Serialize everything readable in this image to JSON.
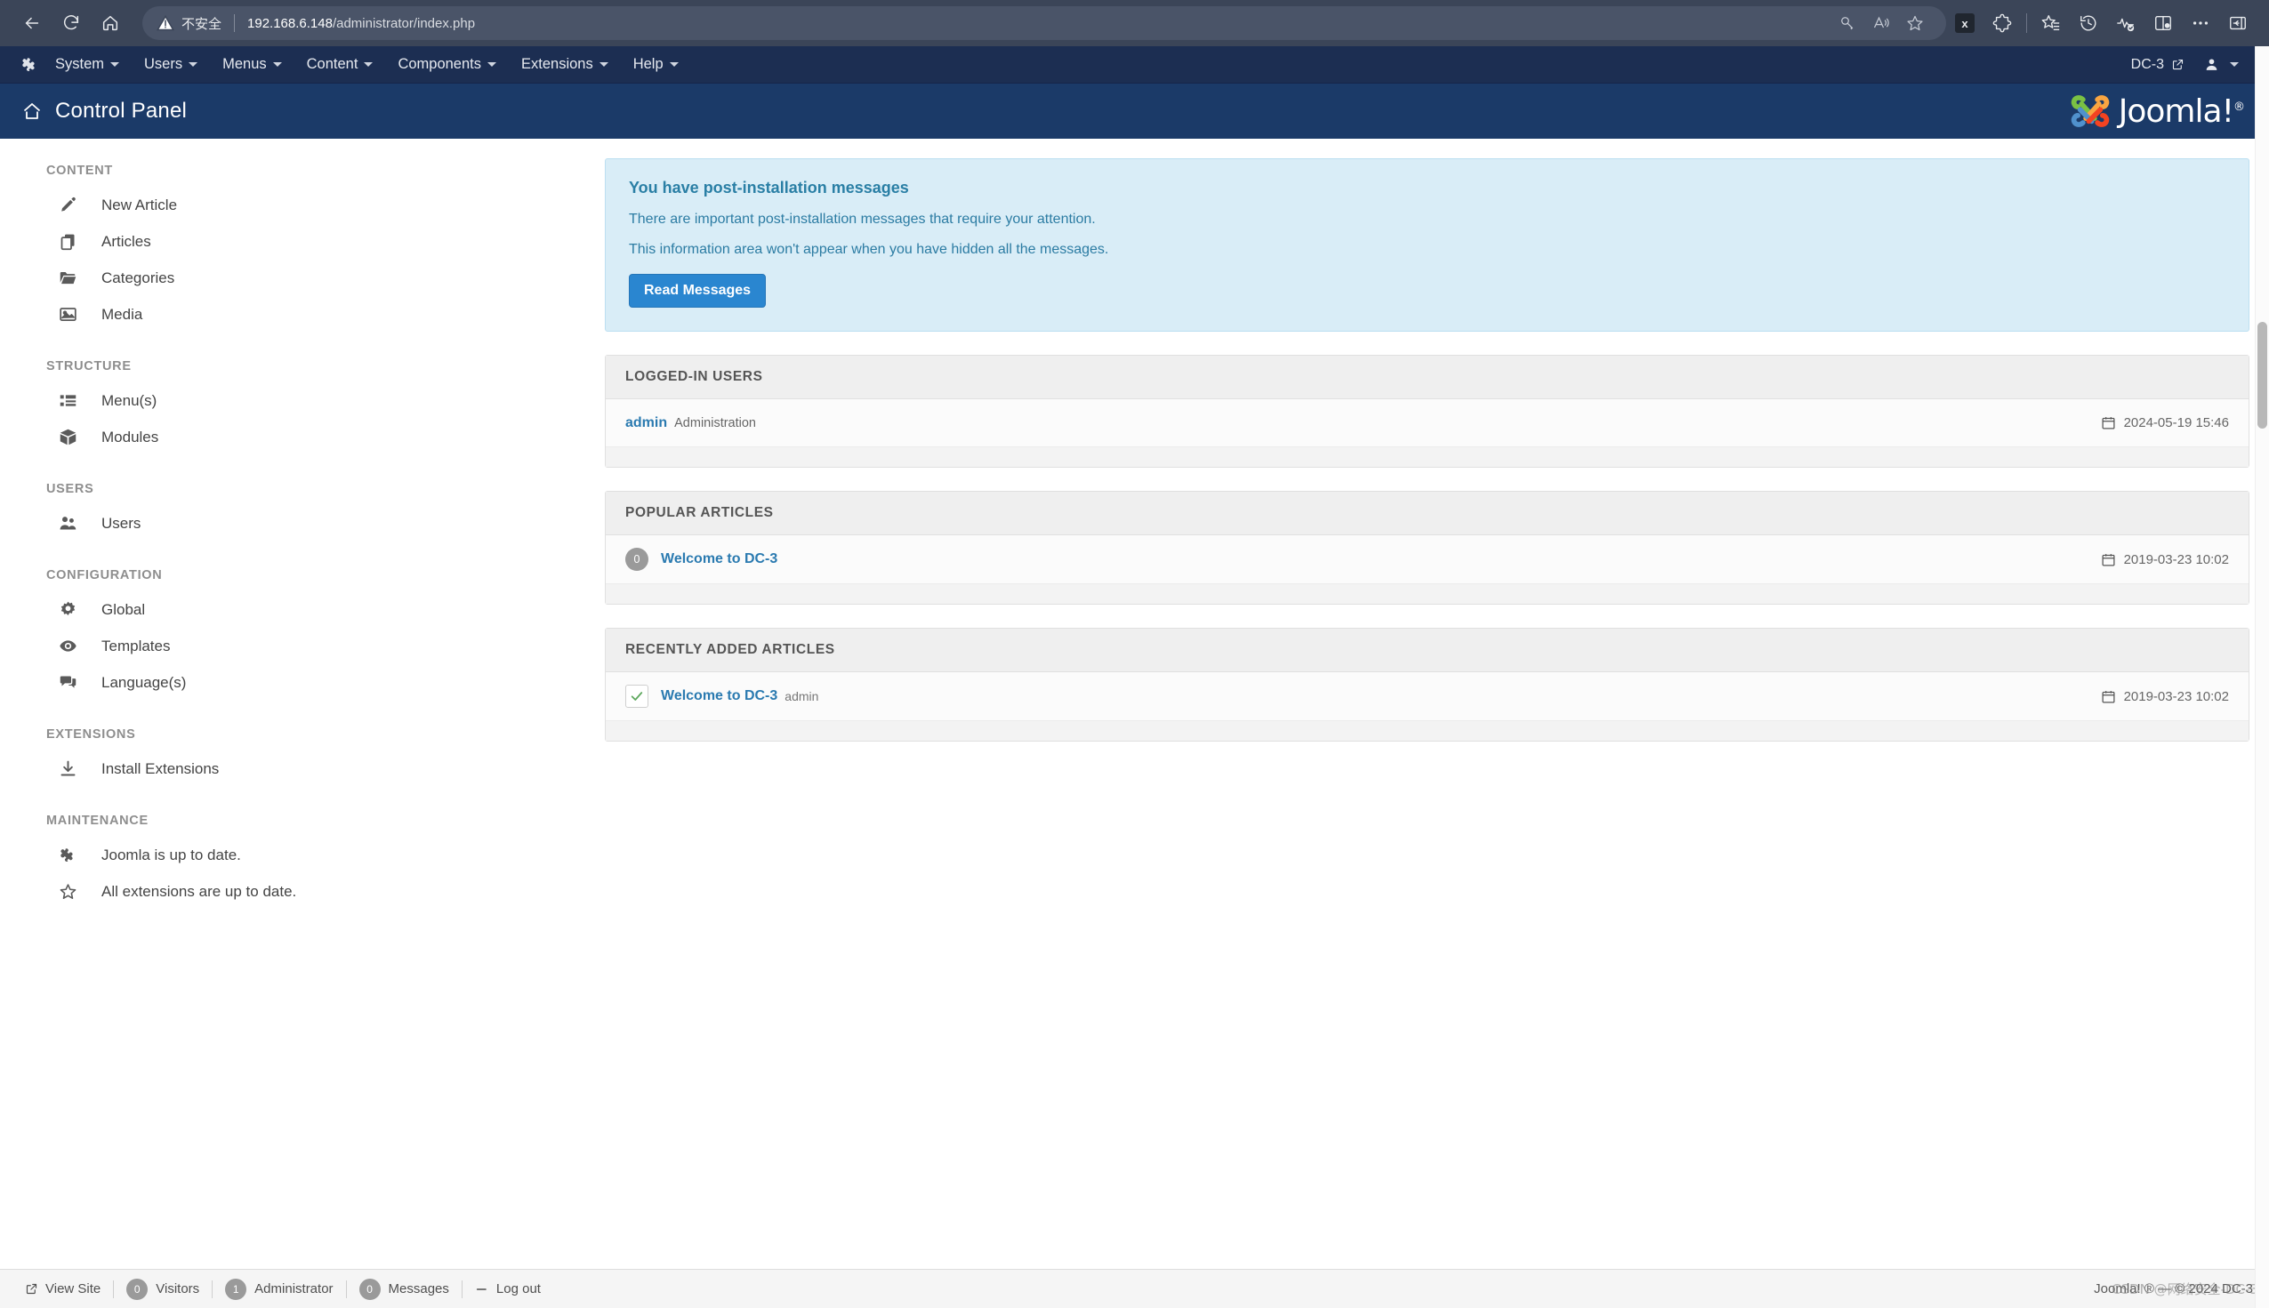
{
  "browser": {
    "back_label": "Back",
    "reload_label": "Reload",
    "home_label": "Home",
    "security_label": "不安全",
    "url_host": "192.168.6.148",
    "url_path": "/administrator/index.php",
    "pill_icons": [
      {
        "name": "key-icon",
        "label": "Key"
      },
      {
        "name": "read-aloud-icon",
        "label": "Read aloud"
      },
      {
        "name": "favorite-star-icon",
        "label": "Add to favorites"
      }
    ],
    "toolbar_icons": [
      {
        "name": "extension-badge-x-icon",
        "label": "X"
      },
      {
        "name": "puzzle-extensions-icon",
        "label": "Extensions"
      },
      {
        "name": "collections-star-icon",
        "label": "Collections"
      },
      {
        "name": "history-clock-icon",
        "label": "History"
      },
      {
        "name": "browser-essentials-icon",
        "label": "Browser essentials"
      },
      {
        "name": "split-screen-icon",
        "label": "Split screen"
      },
      {
        "name": "more-options-icon",
        "label": "Settings and more"
      },
      {
        "name": "sidebar-toggle-icon",
        "label": "Sidebar"
      }
    ]
  },
  "admin_menu": {
    "brand_icon": "joomla-logo-icon",
    "items": [
      {
        "label": "System",
        "has_caret": true
      },
      {
        "label": "Users",
        "has_caret": true
      },
      {
        "label": "Menus",
        "has_caret": true
      },
      {
        "label": "Content",
        "has_caret": true
      },
      {
        "label": "Components",
        "has_caret": true
      },
      {
        "label": "Extensions",
        "has_caret": true
      },
      {
        "label": "Help",
        "has_caret": true
      }
    ],
    "site_name": "DC-3",
    "user_menu_label": ""
  },
  "page_header": {
    "title": "Control Panel",
    "home_icon": "home-icon",
    "logo_text": "Joomla!",
    "logo_registered": "®"
  },
  "sidebar": {
    "groups": [
      {
        "heading": "CONTENT",
        "items": [
          {
            "label": "New Article",
            "icon": "pencil-icon"
          },
          {
            "label": "Articles",
            "icon": "copy-stack-icon"
          },
          {
            "label": "Categories",
            "icon": "folder-icon"
          },
          {
            "label": "Media",
            "icon": "image-icon"
          }
        ]
      },
      {
        "heading": "STRUCTURE",
        "items": [
          {
            "label": "Menu(s)",
            "icon": "list-icon"
          },
          {
            "label": "Modules",
            "icon": "cube-icon"
          }
        ]
      },
      {
        "heading": "USERS",
        "items": [
          {
            "label": "Users",
            "icon": "users-icon"
          }
        ]
      },
      {
        "heading": "CONFIGURATION",
        "items": [
          {
            "label": "Global",
            "icon": "gear-icon"
          },
          {
            "label": "Templates",
            "icon": "eye-icon"
          },
          {
            "label": "Language(s)",
            "icon": "speech-bubble-icon"
          }
        ]
      },
      {
        "heading": "EXTENSIONS",
        "items": [
          {
            "label": "Install Extensions",
            "icon": "download-icon"
          }
        ]
      },
      {
        "heading": "MAINTENANCE",
        "items": [
          {
            "label": "Joomla is up to date.",
            "icon": "joomla-logo-icon"
          },
          {
            "label": "All extensions are up to date.",
            "icon": "star-outline-icon"
          }
        ]
      }
    ]
  },
  "alert": {
    "title": "You have post-installation messages",
    "line1": "There are important post-installation messages that require your attention.",
    "line2": "This information area won't appear when you have hidden all the messages.",
    "button_label": "Read Messages",
    "bg_color": "#d9edf7",
    "text_color": "#2c7ca3",
    "button_color": "#2a86d0"
  },
  "panels": {
    "logged_in_users": {
      "title": "LOGGED-IN USERS",
      "rows": [
        {
          "name": "admin",
          "role": "Administration",
          "date": "2024-05-19 15:46",
          "date_icon": "calendar-icon"
        }
      ]
    },
    "popular_articles": {
      "title": "POPULAR ARTICLES",
      "rows": [
        {
          "hits": "0",
          "title": "Welcome to DC-3",
          "date": "2019-03-23 10:02",
          "date_icon": "calendar-icon"
        }
      ]
    },
    "recently_added_articles": {
      "title": "RECENTLY ADDED ARTICLES",
      "rows": [
        {
          "status_icon": "check-icon",
          "title": "Welcome to DC-3",
          "author": "admin",
          "date": "2019-03-23 10:02",
          "date_icon": "calendar-icon"
        }
      ]
    }
  },
  "footer": {
    "view_site": "View Site",
    "view_site_icon": "external-link-icon",
    "visitors_count": "0",
    "visitors_label": "Visitors",
    "administrator_count": "1",
    "administrator_label": "Administrator",
    "messages_count": "0",
    "messages_label": "Messages",
    "logout_label": "Log out",
    "logout_icon": "minus-icon",
    "copyright": "Joomla! ® — © 2024 DC-3",
    "watermark": "CSDN @网络安全-DC-3"
  }
}
